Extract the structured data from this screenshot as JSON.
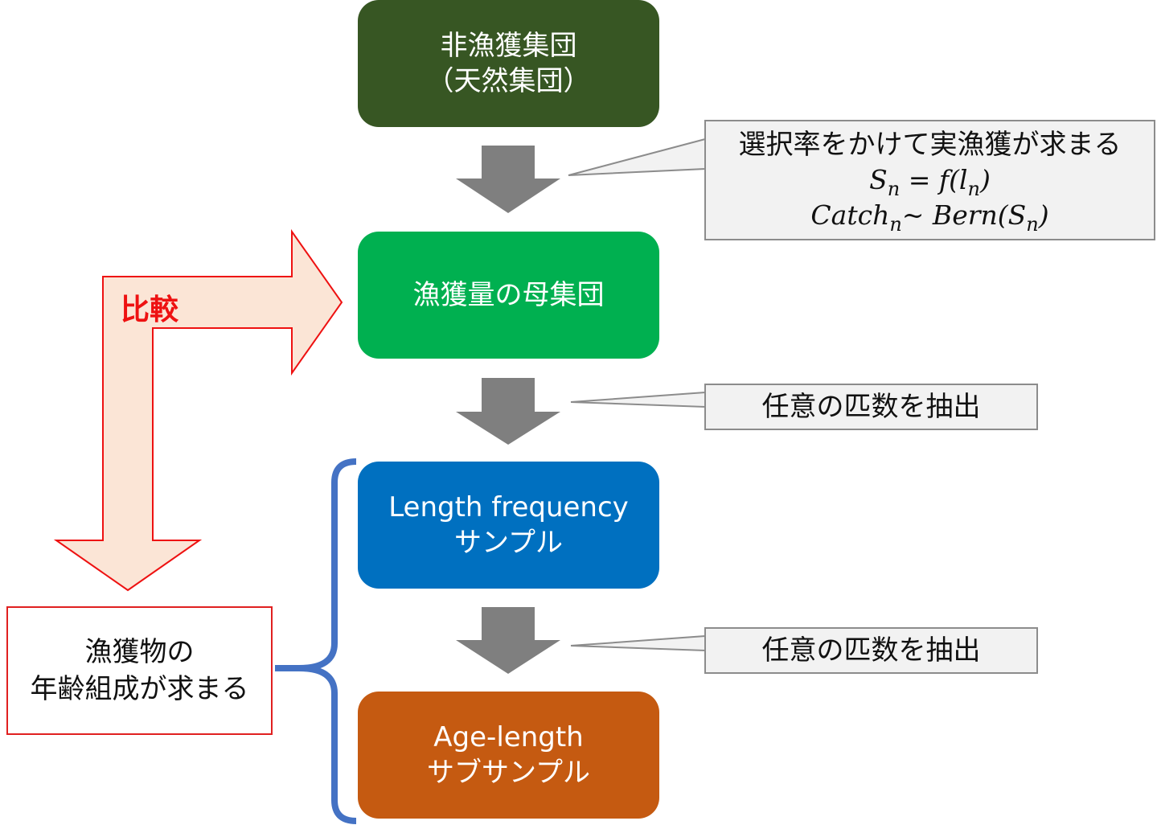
{
  "boxes": {
    "wild": {
      "line1": "非漁獲集団",
      "line2": "（天然集団）",
      "color": "#375623"
    },
    "catch": {
      "line1": "漁獲量の母集団",
      "color": "#00b050"
    },
    "lf": {
      "line1": "Length frequency",
      "line2": "サンプル",
      "color": "#0070c0"
    },
    "al": {
      "line1": "Age-length",
      "line2": "サブサンプル",
      "color": "#c55a11"
    }
  },
  "callouts": {
    "selectivity": {
      "text": "選択率をかけて実漁獲が求まる",
      "eq1": {
        "lhs": "S",
        "lhs_sub": "n",
        "mid": " = f(l",
        "mid_sub": "n",
        "end": ")"
      },
      "eq2": {
        "a": "Catch",
        "a_sub": "n",
        "b": "~ Bern(S",
        "b_sub": "n",
        "c": ")"
      }
    },
    "random1": {
      "text": "任意の匹数を抽出"
    },
    "random2": {
      "text": "任意の匹数を抽出"
    }
  },
  "compare": {
    "label": "比較"
  },
  "result": {
    "line1": "漁獲物の",
    "line2": "年齢組成が求まる"
  },
  "colors": {
    "arrow": "#7f7f7f",
    "compare_fill": "#fbe5d6",
    "compare_stroke": "#ee1111",
    "brace": "#4472c4"
  }
}
